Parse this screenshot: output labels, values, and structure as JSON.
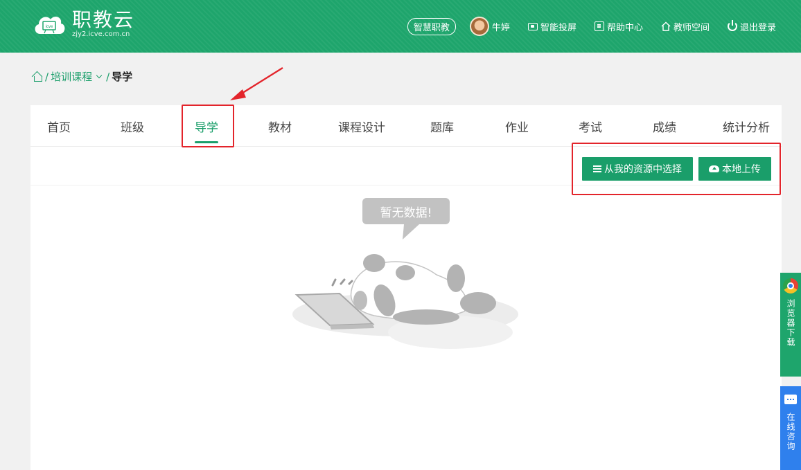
{
  "header": {
    "logo_title": "职教云",
    "logo_sub": "zjy2.icve.com.cn",
    "logo_badge": "icve",
    "pill": "智慧职教",
    "user_name": "牛婷",
    "nav": {
      "screen": "智能投屏",
      "help": "帮助中心",
      "teacher": "教师空间",
      "logout": "退出登录"
    }
  },
  "breadcrumb": {
    "sep": "/",
    "course": "培训课程",
    "current": "导学"
  },
  "tabs": [
    {
      "label": "首页"
    },
    {
      "label": "班级"
    },
    {
      "label": "导学"
    },
    {
      "label": "教材"
    },
    {
      "label": "课程设计"
    },
    {
      "label": "题库"
    },
    {
      "label": "作业"
    },
    {
      "label": "考试"
    },
    {
      "label": "成绩"
    },
    {
      "label": "统计分析"
    }
  ],
  "active_tab": "导学",
  "toolbar": {
    "select_from_resources": "从我的资源中选择",
    "local_upload": "本地上传"
  },
  "empty_state": {
    "message": "暂无数据!"
  },
  "floating": {
    "browser_download": "浏览器下载",
    "online_consult": "在线咨询"
  },
  "colors": {
    "brand_green": "#1ea56c",
    "accent_green": "#1a9e6a",
    "annotation_red": "#e3242b",
    "consult_blue": "#2f80ed"
  }
}
